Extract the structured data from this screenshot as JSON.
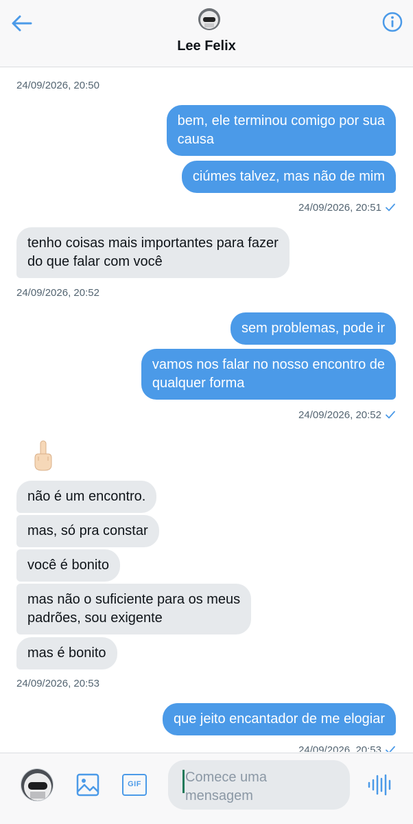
{
  "header": {
    "contact_name": "Lee Felix",
    "back_icon": "arrow-left-icon",
    "info_icon": "info-circle-icon"
  },
  "messages": [
    {
      "type": "timestamp",
      "side": "left",
      "text": "24/09/2026, 20:50"
    },
    {
      "type": "bubble",
      "side": "out",
      "lines": [
        "bem, ele terminou comigo por sua",
        "causa"
      ]
    },
    {
      "type": "bubble",
      "side": "out",
      "lines": [
        "ciúmes talvez, mas não de mim"
      ]
    },
    {
      "type": "timestamp",
      "side": "right",
      "text": "24/09/2026, 20:51",
      "status": "sent"
    },
    {
      "type": "bubble",
      "side": "in",
      "lines": [
        "tenho coisas mais importantes para fazer",
        "do que falar com você"
      ]
    },
    {
      "type": "timestamp",
      "side": "left",
      "text": "24/09/2026, 20:52"
    },
    {
      "type": "bubble",
      "side": "out",
      "lines": [
        "sem problemas, pode ir"
      ]
    },
    {
      "type": "bubble",
      "side": "out",
      "lines": [
        "vamos nos falar no nosso encontro de",
        "qualquer forma"
      ]
    },
    {
      "type": "timestamp",
      "side": "right",
      "text": "24/09/2026, 20:52",
      "status": "sent"
    },
    {
      "type": "emoji",
      "side": "in",
      "emoji": "middle-finger-emoji"
    },
    {
      "type": "bubble",
      "side": "in",
      "lines": [
        "não é um encontro."
      ]
    },
    {
      "type": "bubble",
      "side": "in",
      "lines": [
        "mas, só pra constar"
      ]
    },
    {
      "type": "bubble",
      "side": "in",
      "lines": [
        "você é bonito"
      ]
    },
    {
      "type": "bubble",
      "side": "in",
      "lines": [
        "mas não o suficiente para os meus",
        "padrões, sou exigente"
      ]
    },
    {
      "type": "bubble",
      "side": "in",
      "lines": [
        "mas é bonito"
      ]
    },
    {
      "type": "timestamp",
      "side": "left",
      "text": "24/09/2026, 20:53"
    },
    {
      "type": "bubble",
      "side": "out",
      "lines": [
        "que jeito encantador de me elogiar"
      ]
    },
    {
      "type": "timestamp",
      "side": "right",
      "text": "24/09/2026, 20:53",
      "status": "sent"
    }
  ],
  "composer": {
    "placeholder_line1": "Comece uma",
    "placeholder_line2": "mensagem",
    "image_icon": "image-icon",
    "gif_label": "GIF",
    "voice_icon": "voice-waveform-icon"
  },
  "colors": {
    "accent": "#4b9ae8",
    "incoming_bubble": "#e6e9ec",
    "timestamp": "#536471"
  }
}
